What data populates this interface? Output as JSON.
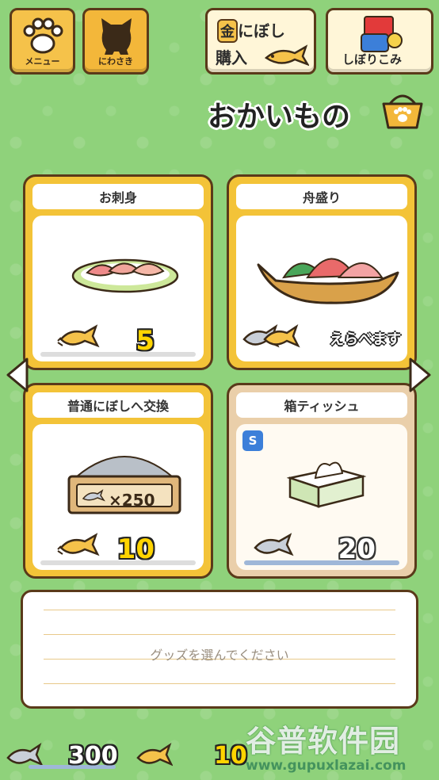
{
  "nav": {
    "menu_label": "メニュー",
    "yard_label": "にわさき",
    "buy_line1": "にぼし",
    "buy_gold": "金",
    "buy_line2": "購入",
    "squeeze_label": "しぼりこみ"
  },
  "shop": {
    "title": "おかいもの"
  },
  "items": [
    {
      "name": "お刺身",
      "price": "5",
      "currency": "gold"
    },
    {
      "name": "舟盛り",
      "price": "えらべます",
      "currency": "choose"
    },
    {
      "name": "普通にぼしへ交換",
      "price": "10",
      "currency": "gold",
      "exchange_label": "×250"
    },
    {
      "name": "箱ティッシュ",
      "price": "20",
      "currency": "silver",
      "badge": "S"
    }
  ],
  "description": {
    "placeholder": "グッズを選んでください"
  },
  "wallet": {
    "silver": "300",
    "gold": "10"
  },
  "watermark": {
    "main": "谷普软件园",
    "url": "www.gupuxlazai.com"
  },
  "colors": {
    "background": "#8fd27b",
    "card_gold": "#f3c338",
    "card_gray": "#eacfaa",
    "gold_text": "#ffd400"
  }
}
